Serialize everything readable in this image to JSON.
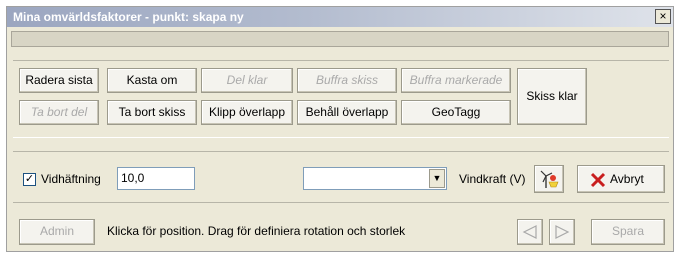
{
  "window": {
    "title": "Mina omvärldsfaktorer - punkt: skapa ny",
    "close_label": "×"
  },
  "toolbar": {
    "row1": {
      "radera_sista": "Radera sista",
      "kasta_om": "Kasta om",
      "del_klar": "Del klar",
      "buffra_skiss": "Buffra skiss",
      "buffra_markerade": "Buffra markerade"
    },
    "row2": {
      "ta_bort_del": "Ta bort del",
      "ta_bort_skiss": "Ta bort skiss",
      "klipp_overlapp": "Klipp överlapp",
      "behall_overlapp": "Behåll överlapp",
      "geotagg": "GeoTagg"
    },
    "skiss_klar": "Skiss klar"
  },
  "options": {
    "vidhaftning_checked": true,
    "vidhaftning_label": "Vidhäftning",
    "vidhaftning_value": "10,0",
    "dropdown_value": "",
    "vindkraft_label": "Vindkraft (V)",
    "avbryt_label": "Avbryt"
  },
  "status": {
    "admin_label": "Admin",
    "message": "Klicka för position. Drag för definiera rotation och storlek",
    "spara_label": "Spara"
  }
}
